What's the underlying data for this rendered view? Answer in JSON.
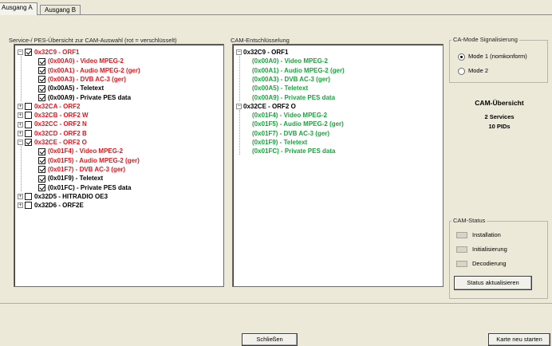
{
  "tabs": [
    "Ausgang A",
    "Ausgang B"
  ],
  "left_panel": {
    "label": "Service-/ PES-Übersicht zur CAM-Auswahl (rot = verschlüsselt)",
    "rows": [
      {
        "text": "0x32C9 - ORF1",
        "level": 0,
        "expander": "−",
        "checked": true,
        "color": "red"
      },
      {
        "text": "(0x00A0) - Video MPEG-2",
        "level": 1,
        "checked": true,
        "color": "red"
      },
      {
        "text": "(0x00A1) - Audio MPEG-2 (ger)",
        "level": 1,
        "checked": true,
        "color": "red"
      },
      {
        "text": "(0x00A3) - DVB AC-3 (ger)",
        "level": 1,
        "checked": true,
        "color": "red"
      },
      {
        "text": "(0x00A5) - Teletext",
        "level": 1,
        "checked": true,
        "color": "black"
      },
      {
        "text": "(0x00A9) - Private PES data",
        "level": 1,
        "checked": true,
        "color": "black"
      },
      {
        "text": "0x32CA - ORF2",
        "level": 0,
        "expander": "+",
        "checked": false,
        "color": "red"
      },
      {
        "text": "0x32CB - ORF2 W",
        "level": 0,
        "expander": "+",
        "checked": false,
        "color": "red"
      },
      {
        "text": "0x32CC - ORF2 N",
        "level": 0,
        "expander": "+",
        "checked": false,
        "color": "red"
      },
      {
        "text": "0x32CD - ORF2 B",
        "level": 0,
        "expander": "+",
        "checked": false,
        "color": "red"
      },
      {
        "text": "0x32CE - ORF2 O",
        "level": 0,
        "expander": "−",
        "checked": true,
        "color": "red"
      },
      {
        "text": "(0x01F4) - Video MPEG-2",
        "level": 1,
        "checked": true,
        "color": "red"
      },
      {
        "text": "(0x01F5) - Audio MPEG-2 (ger)",
        "level": 1,
        "checked": true,
        "color": "red"
      },
      {
        "text": "(0x01F7) - DVB AC-3 (ger)",
        "level": 1,
        "checked": true,
        "color": "red"
      },
      {
        "text": "(0x01F9) - Teletext",
        "level": 1,
        "checked": true,
        "color": "black"
      },
      {
        "text": "(0x01FC) - Private PES data",
        "level": 1,
        "checked": true,
        "color": "black"
      },
      {
        "text": "0x32D5 - HITRADIO OE3",
        "level": 0,
        "expander": "+",
        "checked": false,
        "color": "black"
      },
      {
        "text": "0x32D6 - ORF2E",
        "level": 0,
        "expander": "+",
        "checked": false,
        "color": "black"
      }
    ]
  },
  "middle_panel": {
    "label": "CAM-Entschlüsselung",
    "rows": [
      {
        "text": "0x32C9 - ORF1",
        "level": 0,
        "expander": "−",
        "color": "black"
      },
      {
        "text": "(0x00A0) - Video MPEG-2",
        "level": 1,
        "color": "green"
      },
      {
        "text": "(0x00A1) - Audio MPEG-2 (ger)",
        "level": 1,
        "color": "green"
      },
      {
        "text": "(0x00A3) - DVB AC-3 (ger)",
        "level": 1,
        "color": "green"
      },
      {
        "text": "(0x00A5) - Teletext",
        "level": 1,
        "color": "green"
      },
      {
        "text": "(0x00A9) - Private PES data",
        "level": 1,
        "color": "green"
      },
      {
        "text": "0x32CE - ORF2 O",
        "level": 0,
        "expander": "−",
        "color": "black"
      },
      {
        "text": "(0x01F4) - Video MPEG-2",
        "level": 1,
        "color": "green"
      },
      {
        "text": "(0x01F5) - Audio MPEG-2 (ger)",
        "level": 1,
        "color": "green"
      },
      {
        "text": "(0x01F7) - DVB AC-3 (ger)",
        "level": 1,
        "color": "green"
      },
      {
        "text": "(0x01F9) - Teletext",
        "level": 1,
        "color": "green"
      },
      {
        "text": "(0x01FC) - Private PES data",
        "level": 1,
        "color": "green"
      }
    ]
  },
  "ca_mode": {
    "title": "CA-Mode Signalisierung",
    "options": [
      {
        "label": "Mode 1 (nomkonform)",
        "selected": true
      },
      {
        "label": "Mode 2",
        "selected": false
      }
    ]
  },
  "cam_overview": {
    "title": "CAM-Übersicht",
    "services": "2 Services",
    "pids": "10 PIDs"
  },
  "cam_status": {
    "title": "CAM-Status",
    "items": [
      "Installation",
      "Initialisierung",
      "Decodierung"
    ],
    "update_button": "Status aktualisieren"
  },
  "footer": {
    "close_button": "Schließen",
    "restart_button": "Karte neu starten"
  },
  "colors": {
    "encrypted": "#e8151d",
    "decrypted": "#1aa53c",
    "plain": "#000000",
    "background": "#ece9d8"
  }
}
